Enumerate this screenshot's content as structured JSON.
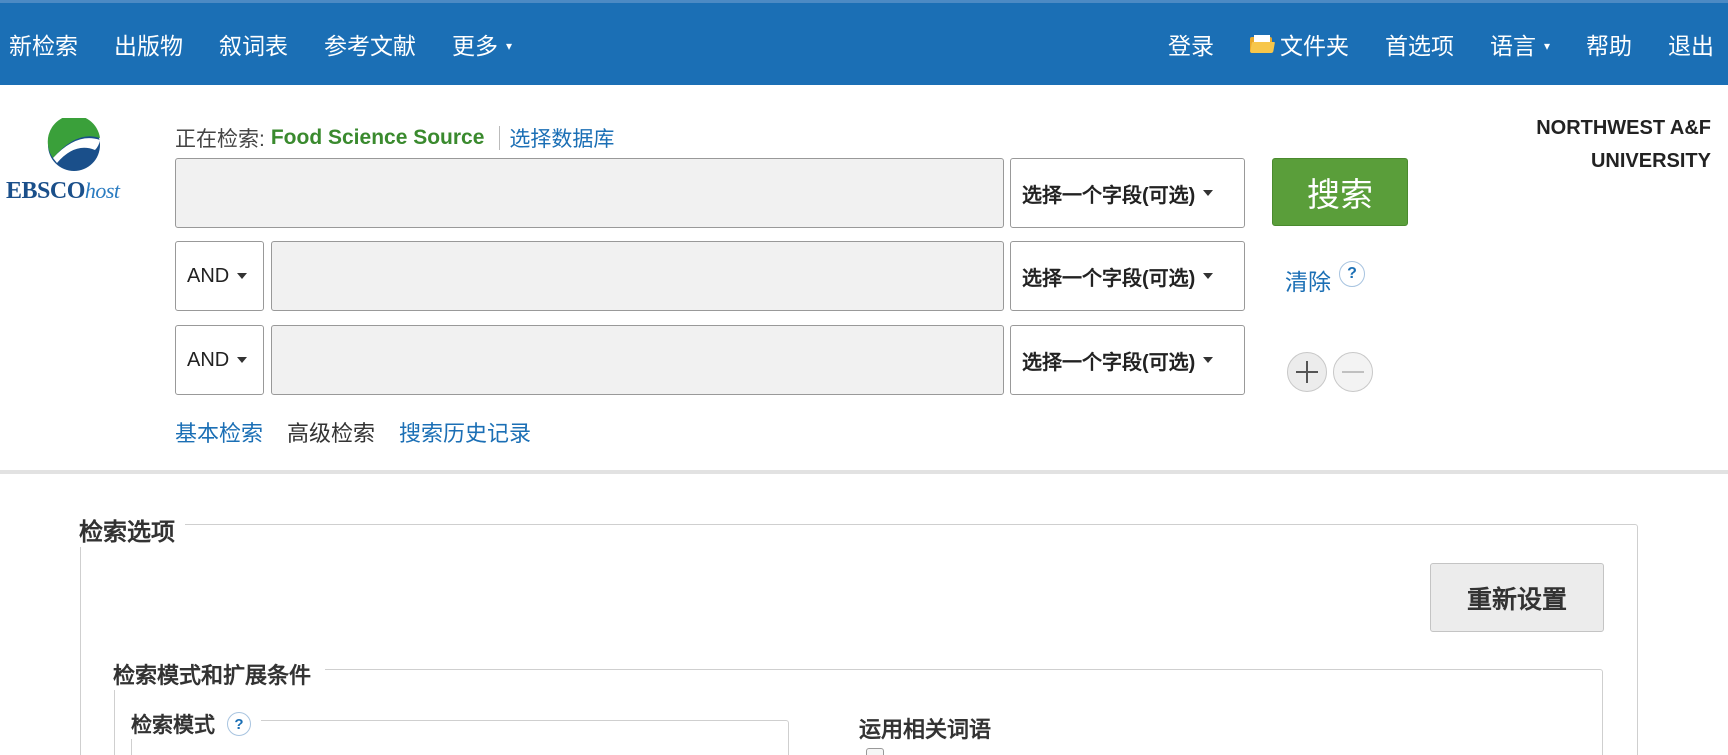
{
  "topnav": {
    "left": [
      {
        "label": "新检索"
      },
      {
        "label": "出版物"
      },
      {
        "label": "叙词表"
      },
      {
        "label": "参考文献"
      },
      {
        "label": "更多",
        "caret": "▾"
      }
    ],
    "login": "登录",
    "folder": "文件夹",
    "preferences": "首选项",
    "language": "语言",
    "language_caret": "▾",
    "help": "帮助",
    "exit": "退出"
  },
  "logo": {
    "brand": "EBSCO",
    "suffix": "host"
  },
  "institution": {
    "line1": "NORTHWEST A&F",
    "line2": "UNIVERSITY"
  },
  "searching": {
    "label": "正在检索:",
    "database": "Food Science Source",
    "choose_db": "选择数据库"
  },
  "search_rows": [
    {
      "value": "",
      "field": "选择一个字段(可选)"
    },
    {
      "bool": "AND",
      "value": "",
      "field": "选择一个字段(可选)"
    },
    {
      "bool": "AND",
      "value": "",
      "field": "选择一个字段(可选)"
    }
  ],
  "search_button": "搜索",
  "clear": "清除",
  "help_q": "?",
  "mode_links": {
    "basic": "基本检索",
    "advanced": "高级检索",
    "history": "搜索历史记录"
  },
  "options": {
    "title": "检索选项",
    "reset": "重新设置",
    "modes_title": "检索模式和扩展条件",
    "mode_label": "检索模式",
    "related_terms": "运用相关词语"
  },
  "colors": {
    "nav": "#1b6fb5",
    "search_button": "#5a9e3a",
    "database": "#3a8a2e",
    "link": "#1b6fb5"
  }
}
